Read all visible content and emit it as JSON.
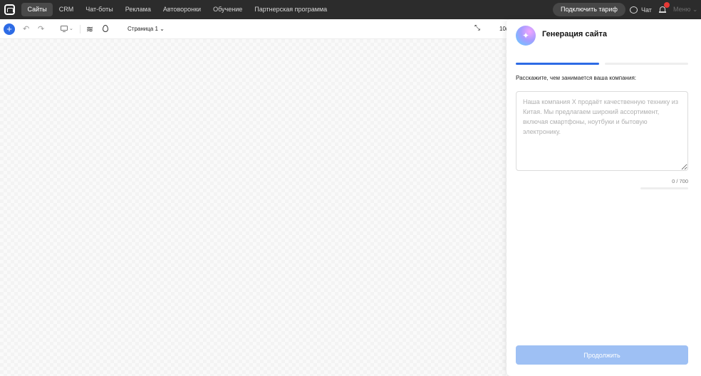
{
  "topbar": {
    "nav": [
      "Сайты",
      "CRM",
      "Чат-боты",
      "Реклама",
      "Автоворонки",
      "Обучение",
      "Партнерская программа"
    ],
    "tariff_button": "Подключить тариф",
    "chat_label": "Чат",
    "menu_label": "Меню"
  },
  "toolbar": {
    "page_selector": "Страница 1",
    "zoom": "10("
  },
  "panel": {
    "title": "Генерация сайта",
    "question": "Расскажите, чем занимается ваша компания:",
    "placeholder": "Наша компания Х продаёт качественную технику из Китая. Мы предлагаем широкий ассортимент, включая смартфоны, ноутбуки и бытовую электронику.",
    "counter": "0 / 700",
    "continue_button": "Продолжить",
    "step_progress": 0.5
  },
  "colors": {
    "accent": "#2d6be5",
    "topbar_bg": "#2c2c2c",
    "button_disabled": "#9ec0f4",
    "notification_dot": "#e53935"
  }
}
